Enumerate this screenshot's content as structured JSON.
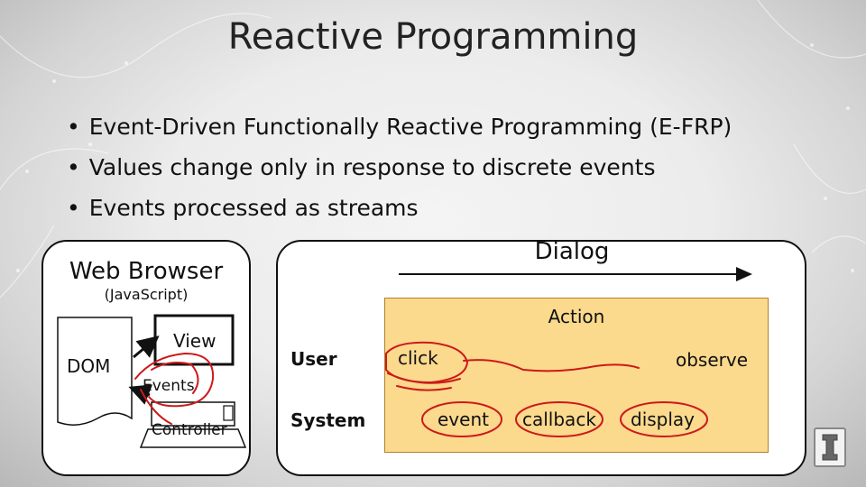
{
  "slide": {
    "title": "Reactive Programming",
    "bullets": [
      "Event-Driven Functionally Reactive Programming (E-FRP)",
      "Values change only in response to discrete events",
      "Events processed as streams"
    ]
  },
  "browser_diagram": {
    "title": "Web Browser",
    "subtitle": "(JavaScript)",
    "dom_label": "DOM",
    "view_label": "View",
    "events_label": "Events",
    "controller_label": "Controller"
  },
  "dialog_diagram": {
    "label": "Dialog",
    "action_label": "Action",
    "rows": {
      "user": {
        "label": "User",
        "items": [
          "click",
          "observe"
        ]
      },
      "system": {
        "label": "System",
        "items": [
          "event",
          "callback",
          "display"
        ]
      }
    }
  },
  "colors": {
    "annotation_ink": "#cc1a1a",
    "action_fill": "#fbd98d",
    "background": "#e9e9e9"
  },
  "icons": [
    "university-logo-icon"
  ]
}
